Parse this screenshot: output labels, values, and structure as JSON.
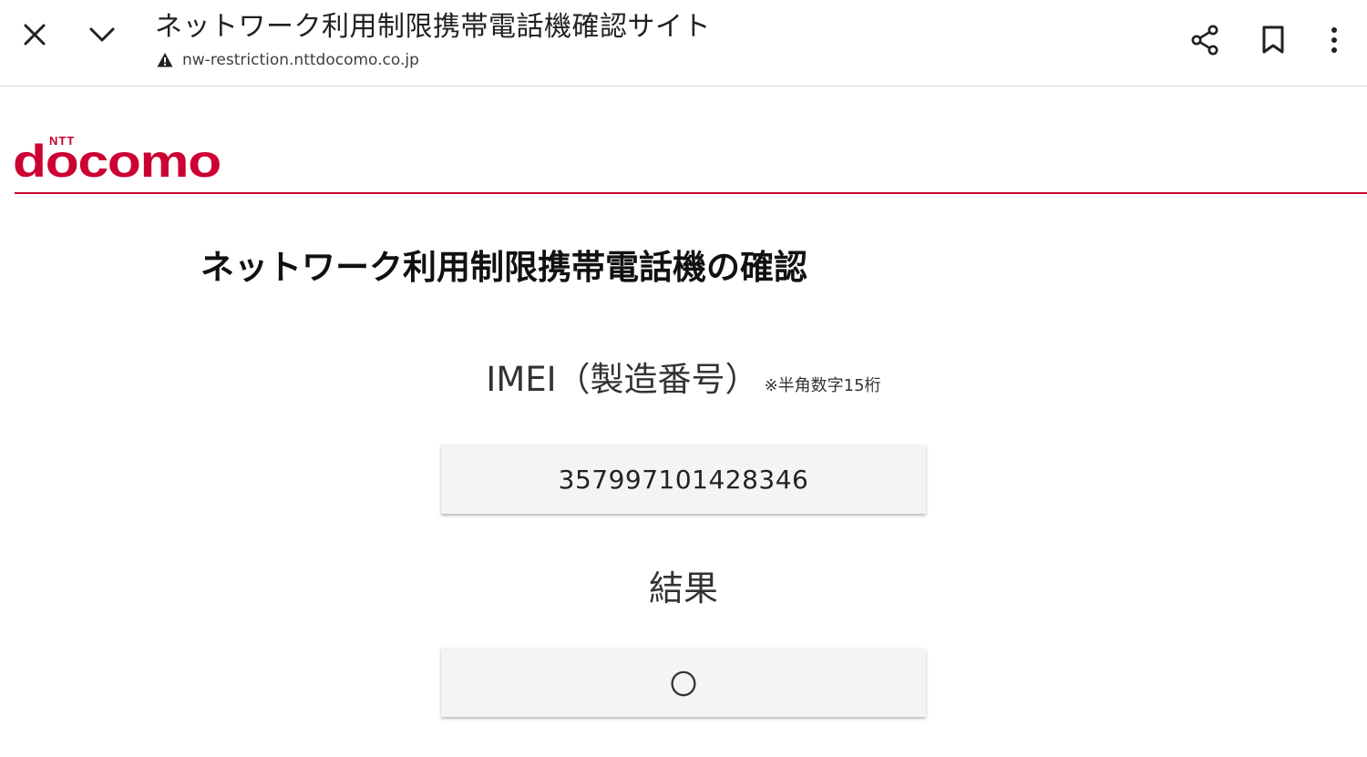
{
  "browser": {
    "page_title": "ネットワーク利用制限携帯電話機確認サイト",
    "url": "nw-restriction.nttdocomo.co.jp",
    "icons": {
      "close": "close-icon",
      "minimize": "chevron-down-icon",
      "security_warning": "warning-icon",
      "share": "share-icon",
      "bookmark": "bookmark-icon",
      "more": "more-vert-icon"
    }
  },
  "brand": {
    "logo_small_text": "NTT",
    "logo_text": "docomo",
    "color": "#cc0033"
  },
  "main": {
    "heading": "ネットワーク利用制限携帯電話機の確認",
    "imei_label": "IMEI（製造番号）",
    "imei_note": "※半角数字15桁",
    "imei_value": "357997101428346",
    "result_label": "結果",
    "result_value": "〇"
  }
}
